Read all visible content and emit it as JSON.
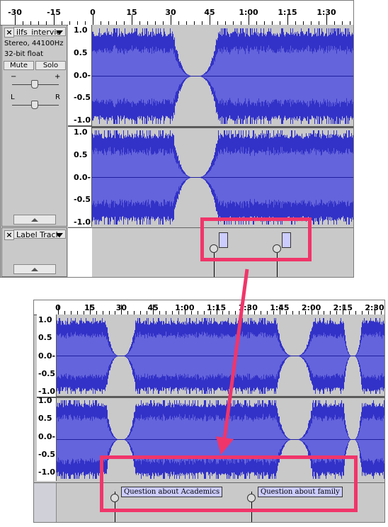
{
  "top": {
    "ruler": {
      "labels": [
        "-30",
        "-15",
        "0",
        "15",
        "30",
        "45",
        "1:00",
        "1:15",
        "1:30"
      ]
    },
    "audio_track": {
      "name": "ilfs_intervie",
      "info_line1": "Stereo, 44100Hz",
      "info_line2": "32-bit float",
      "mute_label": "Mute",
      "solo_label": "Solo",
      "gain_minus": "−",
      "gain_plus": "+",
      "pan_left": "L",
      "pan_right": "R",
      "amp_labels": [
        "1.0",
        "0.5",
        "0.0-",
        "-0.5",
        "-1.0"
      ]
    },
    "label_track": {
      "name": "Label Track"
    }
  },
  "bottom": {
    "ruler": {
      "labels": [
        "0",
        "15",
        "30",
        "45",
        "1:00",
        "1:15",
        "1:30",
        "1:45",
        "2:00",
        "2:15",
        "2:30"
      ]
    },
    "amp_labels": [
      "1.0",
      "0.5",
      "0.0-",
      "-0.5",
      "-1.0"
    ],
    "labels": [
      "Question about Academics",
      "Question about family"
    ]
  },
  "colors": {
    "waveform": "#3232c8",
    "waveform_light": "#6464dc",
    "background": "#c9c9c9",
    "highlight": "#f0356a",
    "label_fill": "#ccccff"
  },
  "icons": {
    "close": "×",
    "dropdown": "chevron-down-icon",
    "collapse": "chevron-up-icon"
  }
}
